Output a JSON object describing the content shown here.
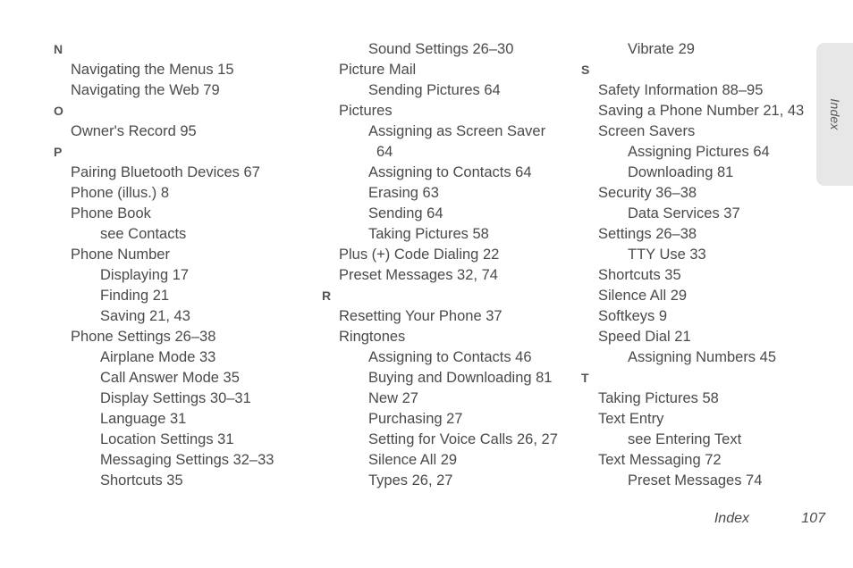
{
  "page": {
    "side_tab_label": "Index",
    "footer_label": "Index",
    "footer_page": "107",
    "tab_color": "#e7e7e7",
    "text_color": "#4a4a4a",
    "letter_color": "#555555"
  },
  "columns": [
    {
      "id": "column-1",
      "blocks": [
        {
          "letter": "N",
          "entries": [
            {
              "level": 1,
              "text": "Navigating the Menus 15"
            },
            {
              "level": 1,
              "text": "Navigating the Web 79"
            }
          ]
        },
        {
          "letter": "O",
          "entries": [
            {
              "level": 1,
              "text": "Owner's Record 95"
            }
          ]
        },
        {
          "letter": "P",
          "entries": [
            {
              "level": 1,
              "text": "Pairing Bluetooth Devices 67"
            },
            {
              "level": 1,
              "text": "Phone (illus.) 8"
            },
            {
              "level": 1,
              "text": "Phone Book"
            },
            {
              "level": 2,
              "text": "see Contacts"
            },
            {
              "level": 1,
              "text": "Phone Number"
            },
            {
              "level": 2,
              "text": "Displaying 17"
            },
            {
              "level": 2,
              "text": "Finding 21"
            },
            {
              "level": 2,
              "text": "Saving 21, 43"
            },
            {
              "level": 1,
              "text": "Phone Settings 26–38"
            },
            {
              "level": 2,
              "text": "Airplane Mode 33"
            },
            {
              "level": 2,
              "text": "Call Answer Mode 35"
            },
            {
              "level": 2,
              "text": "Display Settings 30–31"
            },
            {
              "level": 2,
              "text": "Language 31"
            },
            {
              "level": 2,
              "text": "Location Settings 31"
            },
            {
              "level": 2,
              "text": "Messaging Settings 32–33"
            },
            {
              "level": 2,
              "text": "Shortcuts 35"
            }
          ]
        }
      ]
    },
    {
      "id": "column-2",
      "blocks": [
        {
          "letter": "",
          "entries": [
            {
              "level": 2,
              "text": "Sound Settings 26–30"
            },
            {
              "level": 1,
              "text": "Picture Mail"
            },
            {
              "level": 2,
              "text": "Sending Pictures 64"
            },
            {
              "level": 1,
              "text": "Pictures"
            },
            {
              "level": 2,
              "text": "Assigning as Screen Saver"
            },
            {
              "level": 3,
              "text": "64"
            },
            {
              "level": 2,
              "text": "Assigning to Contacts 64"
            },
            {
              "level": 2,
              "text": "Erasing 63"
            },
            {
              "level": 2,
              "text": "Sending 64"
            },
            {
              "level": 2,
              "text": "Taking Pictures 58"
            },
            {
              "level": 1,
              "text": "Plus (+) Code Dialing 22"
            },
            {
              "level": 1,
              "text": "Preset Messages 32, 74"
            }
          ]
        },
        {
          "letter": "R",
          "entries": [
            {
              "level": 1,
              "text": "Resetting Your Phone 37"
            },
            {
              "level": 1,
              "text": "Ringtones"
            },
            {
              "level": 2,
              "text": "Assigning to Contacts 46"
            },
            {
              "level": 2,
              "text": "Buying and Downloading 81"
            },
            {
              "level": 2,
              "text": "New 27"
            },
            {
              "level": 2,
              "text": "Purchasing 27"
            },
            {
              "level": 2,
              "text": "Setting for Voice Calls 26, 27"
            },
            {
              "level": 2,
              "text": "Silence All 29"
            },
            {
              "level": 2,
              "text": "Types 26, 27"
            }
          ]
        }
      ]
    },
    {
      "id": "column-3",
      "blocks": [
        {
          "letter": "",
          "entries": [
            {
              "level": 2,
              "text": "Vibrate 29"
            }
          ]
        },
        {
          "letter": "S",
          "entries": [
            {
              "level": 1,
              "text": "Safety Information 88–95"
            },
            {
              "level": 1,
              "text": "Saving a Phone Number 21, 43"
            },
            {
              "level": 1,
              "text": "Screen Savers"
            },
            {
              "level": 2,
              "text": "Assigning Pictures 64"
            },
            {
              "level": 2,
              "text": "Downloading 81"
            },
            {
              "level": 1,
              "text": "Security 36–38"
            },
            {
              "level": 2,
              "text": "Data Services 37"
            },
            {
              "level": 1,
              "text": "Settings 26–38"
            },
            {
              "level": 2,
              "text": "TTY Use 33"
            },
            {
              "level": 1,
              "text": "Shortcuts 35"
            },
            {
              "level": 1,
              "text": "Silence All 29"
            },
            {
              "level": 1,
              "text": "Softkeys 9"
            },
            {
              "level": 1,
              "text": "Speed Dial 21"
            },
            {
              "level": 2,
              "text": "Assigning Numbers 45"
            }
          ]
        },
        {
          "letter": "T",
          "entries": [
            {
              "level": 1,
              "text": "Taking Pictures 58"
            },
            {
              "level": 1,
              "text": "Text Entry"
            },
            {
              "level": 2,
              "text": "see Entering Text"
            },
            {
              "level": 1,
              "text": "Text Messaging 72"
            },
            {
              "level": 2,
              "text": "Preset Messages 74"
            }
          ]
        }
      ]
    }
  ]
}
